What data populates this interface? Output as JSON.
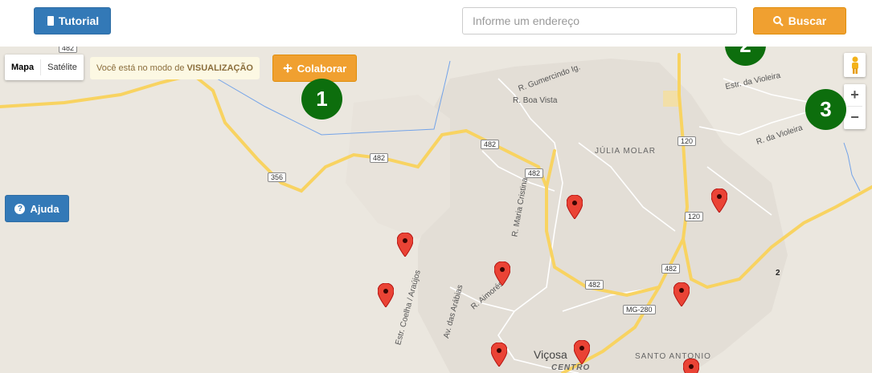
{
  "header": {
    "tutorial_label": "Tutorial",
    "search_placeholder": "Informe um endereço",
    "search_button_label": "Buscar"
  },
  "map": {
    "type_control": {
      "options": [
        "Mapa",
        "Satélite"
      ],
      "active": "Mapa"
    },
    "mode_banner": {
      "text": "Você está no modo de",
      "mode": "VISUALIZAÇÃO"
    },
    "colaborar_label": "Colaborar",
    "ajuda_label": "Ajuda",
    "zoom_in": "+",
    "zoom_out": "−",
    "steps": [
      "1",
      "2",
      "3"
    ],
    "labels": {
      "r_gumercindo": "R. Gumercindo Ig.",
      "r_boa_vista": "R. Boa Vista",
      "julia_molar": "JÚLIA MOLAR",
      "estr_violeira": "Estr. da Violeira",
      "r_violeira": "R. da Violeira",
      "r_maria_cristina": "R. Maria Cristina",
      "r_aimores": "R. Aimorés",
      "av_arabias": "Av. das Arábias",
      "estr_coelha": "Estr. Coelha / Araújos",
      "vicosa": "Viçosa",
      "centro": "CENTRO",
      "santo_antonio": "SANTO ANTONIO",
      "num_2": "2"
    },
    "shields": {
      "s482_top": "482",
      "s482_a": "482",
      "s482_b": "482",
      "s482_c": "482",
      "s482_d": "482",
      "s482_e": "482",
      "s356": "356",
      "s120_a": "120",
      "s120_b": "120",
      "mg280": "MG-280"
    }
  },
  "colors": {
    "primary_blue": "#3379b7",
    "accent_orange": "#f0a030",
    "step_green": "#0d6e0d",
    "road_yellow": "#f8d361",
    "pin_red": "#ea4335"
  }
}
